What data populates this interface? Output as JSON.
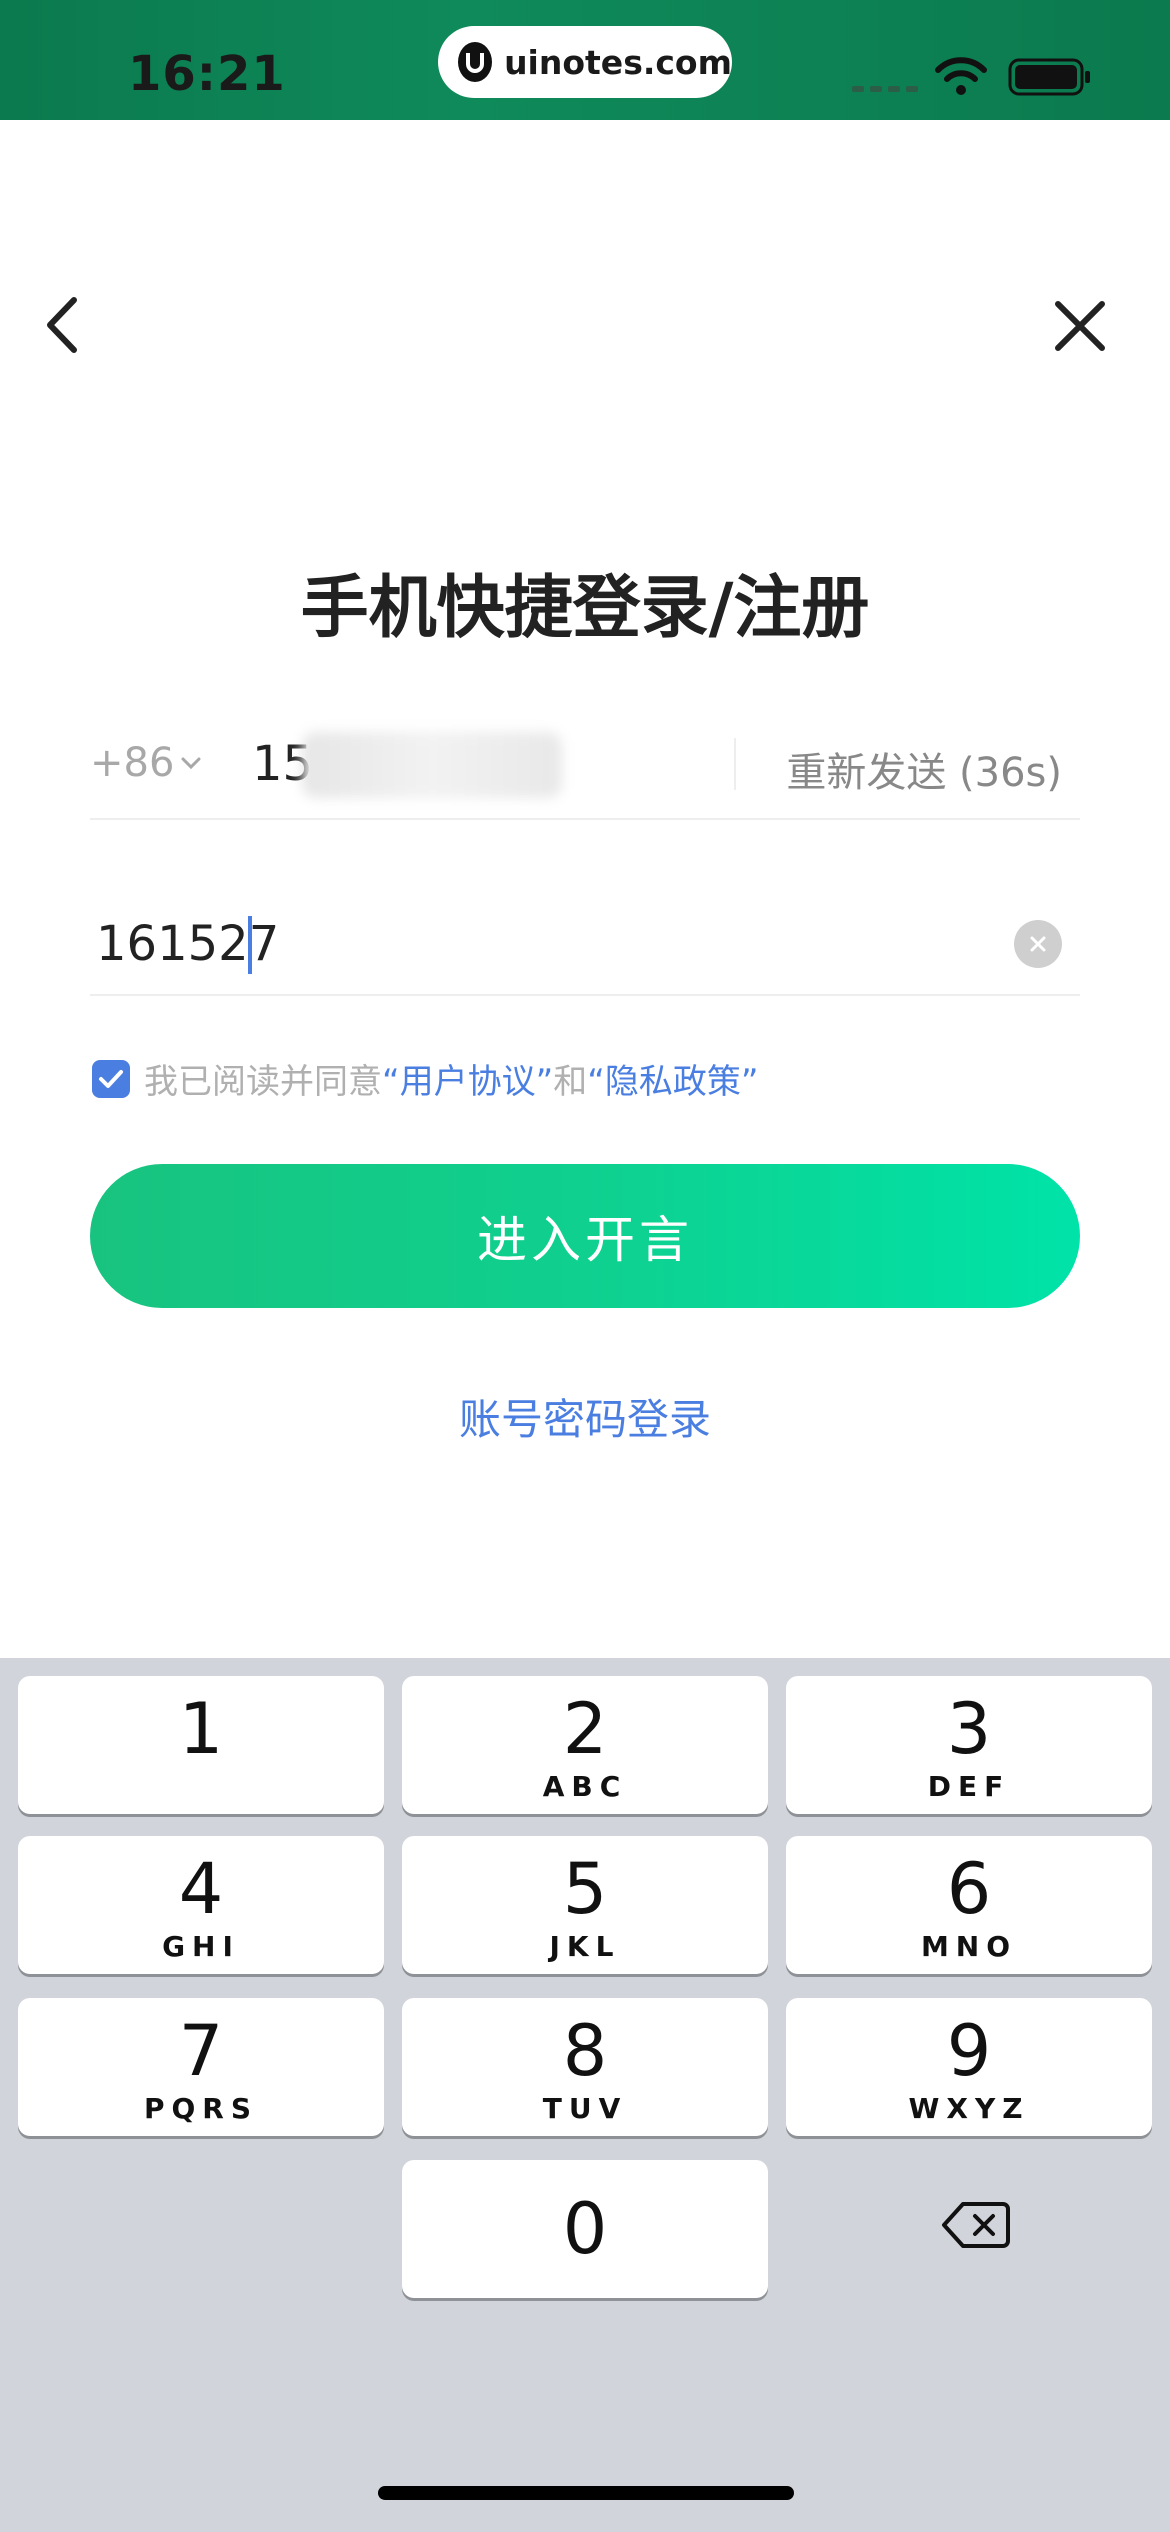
{
  "status_bar": {
    "time": "16:21",
    "url": "uinotes.com",
    "icons": [
      "signal-icon",
      "wifi-icon",
      "battery-icon"
    ]
  },
  "nav": {
    "back_icon": "chevron-left-icon",
    "close_icon": "close-icon"
  },
  "page": {
    "title": "手机快捷登录/注册"
  },
  "phone_field": {
    "country_code": "+86",
    "number_visible": "15",
    "resend_label": "重新发送 (36s)"
  },
  "code_field": {
    "value": "161527"
  },
  "agreement": {
    "prefix": "我已阅读并同意",
    "user_agreement": "“用户协议”",
    "and": "和",
    "privacy_policy": "“隐私政策”",
    "checked": true
  },
  "buttons": {
    "enter": "进入开言",
    "password_login": "账号密码登录"
  },
  "keyboard": {
    "keys": [
      {
        "digit": "1",
        "letters": ""
      },
      {
        "digit": "2",
        "letters": "ABC"
      },
      {
        "digit": "3",
        "letters": "DEF"
      },
      {
        "digit": "4",
        "letters": "GHI"
      },
      {
        "digit": "5",
        "letters": "JKL"
      },
      {
        "digit": "6",
        "letters": "MNO"
      },
      {
        "digit": "7",
        "letters": "PQRS"
      },
      {
        "digit": "8",
        "letters": "TUV"
      },
      {
        "digit": "9",
        "letters": "WXYZ"
      },
      {
        "digit": "0",
        "letters": ""
      }
    ],
    "delete_icon": "backspace-icon"
  },
  "colors": {
    "status_bar": "#0b7a4e",
    "accent_blue": "#4a7ee0",
    "button_start": "#18c37f",
    "button_end": "#00e3a8",
    "keyboard_bg": "#d1d4da"
  }
}
